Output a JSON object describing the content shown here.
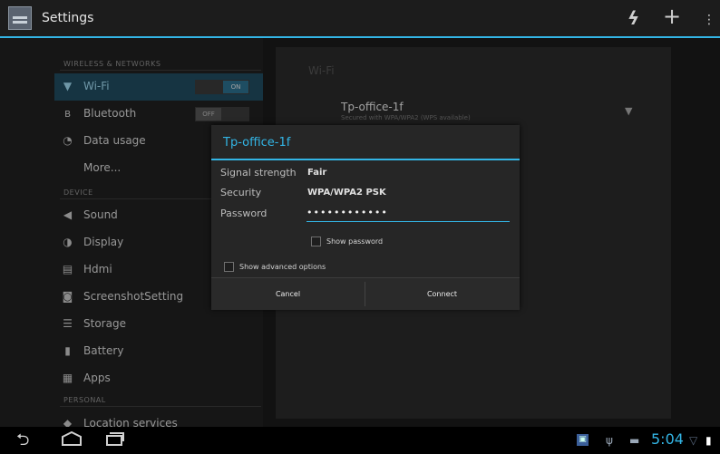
{
  "app": {
    "title": "Settings"
  },
  "actionbar": {
    "icons": [
      "refresh-icon",
      "add-icon",
      "overflow-menu-icon"
    ]
  },
  "sidebar": {
    "sections": [
      {
        "header": "WIRELESS & NETWORKS"
      },
      {
        "header": "DEVICE"
      },
      {
        "header": "PERSONAL"
      }
    ],
    "items": [
      {
        "label": "Wi-Fi",
        "icon": "wifi-icon",
        "selected": true,
        "toggle": "ON"
      },
      {
        "label": "Bluetooth",
        "icon": "bluetooth-icon",
        "toggle": "OFF"
      },
      {
        "label": "Data usage",
        "icon": "data-usage-icon"
      },
      {
        "label": "More..."
      },
      {
        "label": "Sound",
        "icon": "sound-icon"
      },
      {
        "label": "Display",
        "icon": "display-icon"
      },
      {
        "label": "Hdmi",
        "icon": "hdmi-icon"
      },
      {
        "label": "ScreenshotSetting",
        "icon": "screenshot-icon"
      },
      {
        "label": "Storage",
        "icon": "storage-icon"
      },
      {
        "label": "Battery",
        "icon": "battery-icon"
      },
      {
        "label": "Apps",
        "icon": "apps-icon"
      },
      {
        "label": "Location services",
        "icon": "location-icon"
      }
    ]
  },
  "wifi_pane": {
    "title": "Wi-Fi",
    "network": {
      "name": "Tp-office-1f",
      "subtitle": "Secured with WPA/WPA2 (WPS available)",
      "icon": "wifi-signal-icon"
    }
  },
  "dialog": {
    "title": "Tp-office-1f",
    "signal_label": "Signal strength",
    "signal_value": "Fair",
    "security_label": "Security",
    "security_value": "WPA/WPA2 PSK",
    "password_label": "Password",
    "password_value": "••••••••••••",
    "show_password": "Show password",
    "show_advanced": "Show advanced options",
    "cancel": "Cancel",
    "connect": "Connect"
  },
  "navbar": {
    "icons": [
      "back-icon",
      "home-icon",
      "recent-apps-icon"
    ]
  },
  "statusbar": {
    "time": "5:04",
    "icons": [
      "app-notification-icon",
      "usb-icon",
      "battery-status-icon",
      "wifi-status-icon",
      "battery-level-icon"
    ]
  },
  "colors": {
    "accent": "#33b5e5",
    "selected_item": "#204b5f",
    "background": "#202020"
  }
}
